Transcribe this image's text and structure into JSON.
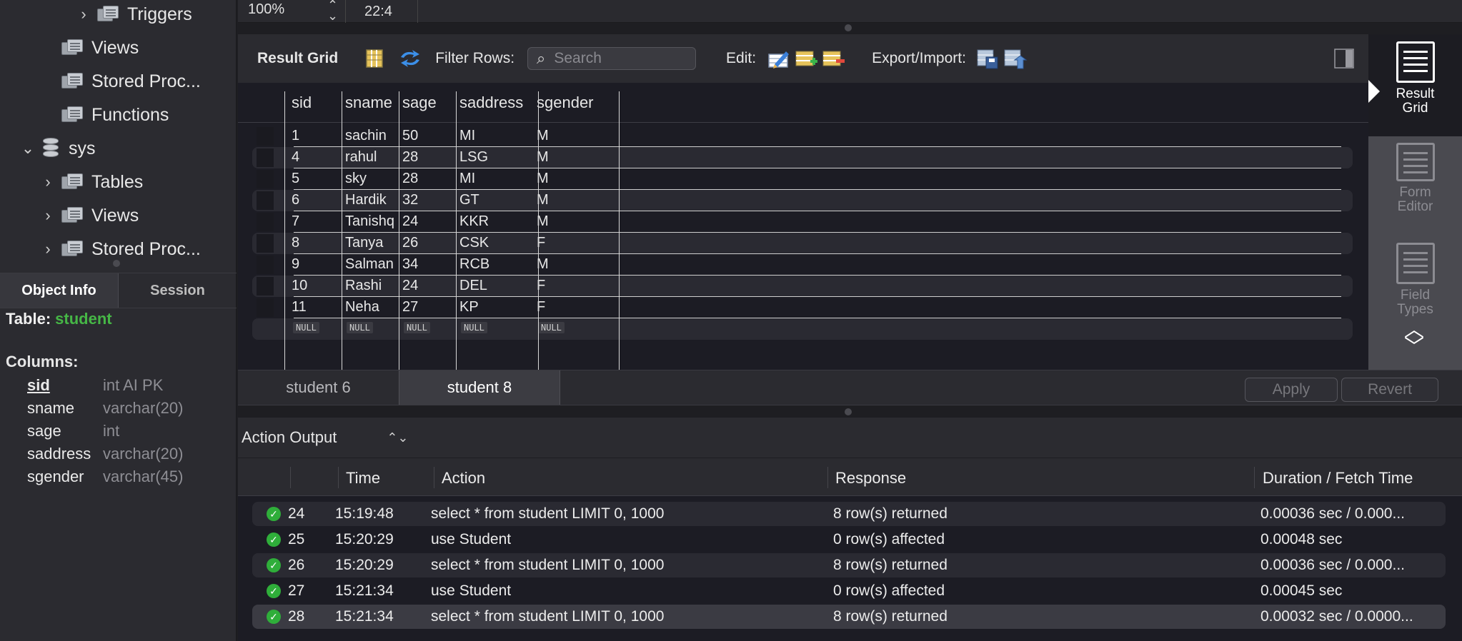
{
  "navigator": {
    "tree": [
      {
        "label": "Triggers",
        "indent": 2,
        "kind": "folder",
        "chevron": ">"
      },
      {
        "label": "Views",
        "indent": 1,
        "kind": "folder",
        "chevron": ""
      },
      {
        "label": "Stored Proc...",
        "indent": 1,
        "kind": "folder",
        "chevron": ""
      },
      {
        "label": "Functions",
        "indent": 1,
        "kind": "folder",
        "chevron": ""
      },
      {
        "label": "sys",
        "indent": 0,
        "kind": "db",
        "chevron": "v"
      },
      {
        "label": "Tables",
        "indent": 1,
        "kind": "folder",
        "chevron": ">"
      },
      {
        "label": "Views",
        "indent": 1,
        "kind": "folder",
        "chevron": ">"
      },
      {
        "label": "Stored Proc...",
        "indent": 1,
        "kind": "folder",
        "chevron": ">"
      }
    ]
  },
  "info_tabs": {
    "object_info": "Object Info",
    "session": "Session"
  },
  "object_info": {
    "table_label": "Table:",
    "table_name": "student",
    "columns_label": "Columns:",
    "columns": [
      {
        "name": "sid",
        "type": "int AI PK",
        "primary": true
      },
      {
        "name": "sname",
        "type": "varchar(20)",
        "primary": false
      },
      {
        "name": "sage",
        "type": "int",
        "primary": false
      },
      {
        "name": "saddress",
        "type": "varchar(20)",
        "primary": false
      },
      {
        "name": "sgender",
        "type": "varchar(45)",
        "primary": false
      }
    ]
  },
  "editor_status": {
    "zoom": "100%",
    "cursor": "22:4"
  },
  "result_toolbar": {
    "title": "Result Grid",
    "filter_label": "Filter Rows:",
    "search_placeholder": "Search",
    "edit_label": "Edit:",
    "export_label": "Export/Import:"
  },
  "grid": {
    "columns": [
      "sid",
      "sname",
      "sage",
      "saddress",
      "sgender"
    ],
    "rows": [
      [
        "1",
        "sachin",
        "50",
        "MI",
        "M"
      ],
      [
        "4",
        "rahul",
        "28",
        "LSG",
        "M"
      ],
      [
        "5",
        "sky",
        "28",
        "MI",
        "M"
      ],
      [
        "6",
        "Hardik",
        "32",
        "GT",
        "M"
      ],
      [
        "7",
        "Tanishq",
        "24",
        "KKR",
        "M"
      ],
      [
        "8",
        "Tanya",
        "26",
        "CSK",
        "F"
      ],
      [
        "9",
        "Salman",
        "34",
        "RCB",
        "M"
      ],
      [
        "10",
        "Rashi",
        "24",
        "DEL",
        "F"
      ],
      [
        "11",
        "Neha",
        "27",
        "KP",
        "F"
      ]
    ],
    "null_text": "NULL"
  },
  "result_tabs": [
    {
      "label": "student 6",
      "active": false
    },
    {
      "label": "student 8",
      "active": true
    }
  ],
  "buttons": {
    "apply": "Apply",
    "revert": "Revert"
  },
  "side_panel": {
    "result_grid": "Result Grid",
    "form_editor": "Form Editor",
    "field_types": "Field Types"
  },
  "action_output": {
    "selector_label": "Action Output",
    "headers": {
      "time": "Time",
      "action": "Action",
      "response": "Response",
      "duration": "Duration / Fetch Time"
    },
    "rows": [
      {
        "num": "24",
        "time": "15:19:48",
        "action": "select * from student LIMIT 0, 1000",
        "response": "8 row(s) returned",
        "duration": "0.00036 sec / 0.000..."
      },
      {
        "num": "25",
        "time": "15:20:29",
        "action": "use Student",
        "response": "0 row(s) affected",
        "duration": "0.00048 sec"
      },
      {
        "num": "26",
        "time": "15:20:29",
        "action": "select * from student LIMIT 0, 1000",
        "response": "8 row(s) returned",
        "duration": "0.00036 sec / 0.000..."
      },
      {
        "num": "27",
        "time": "15:21:34",
        "action": "use Student",
        "response": "0 row(s) affected",
        "duration": "0.00045 sec"
      },
      {
        "num": "28",
        "time": "15:21:34",
        "action": "select * from student LIMIT 0, 1000",
        "response": "8 row(s) returned",
        "duration": "0.00032 sec / 0.0000..."
      }
    ],
    "status_color": "#2fae3a"
  }
}
